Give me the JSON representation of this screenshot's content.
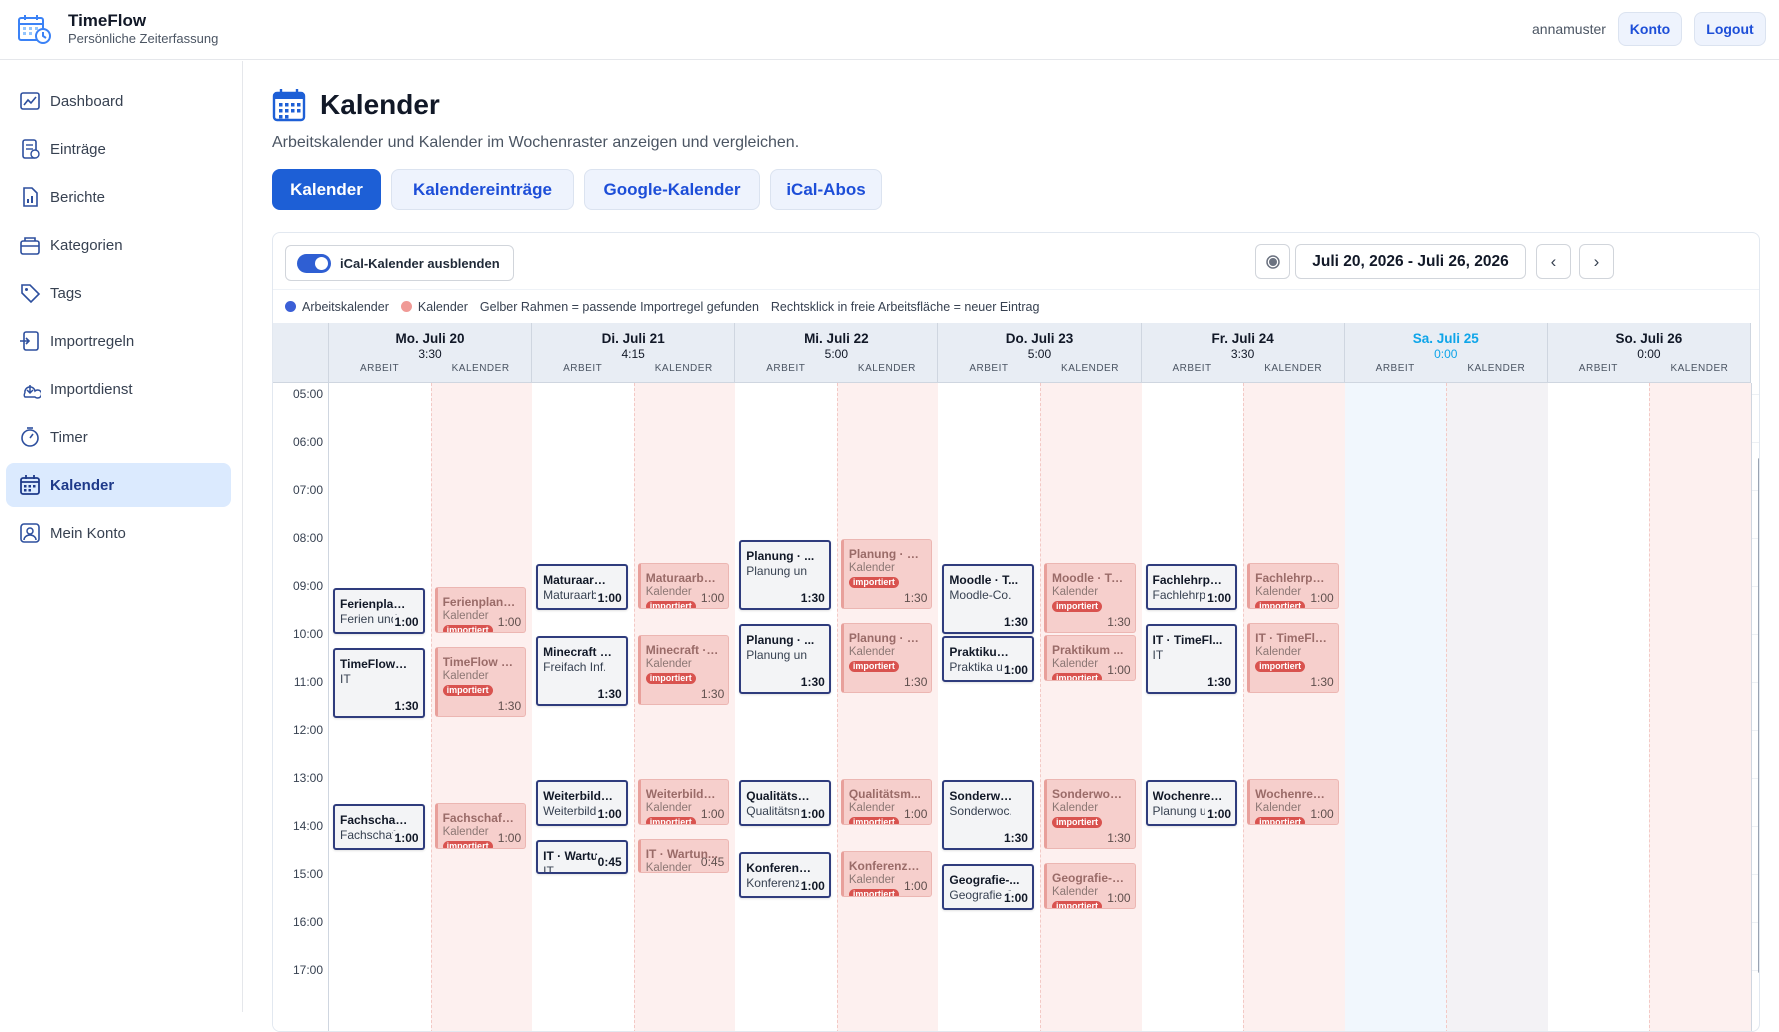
{
  "app": {
    "name": "TimeFlow",
    "subtitle": "Persönliche Zeiterfassung"
  },
  "header": {
    "username": "annamuster",
    "account_label": "Konto",
    "logout_label": "Logout"
  },
  "sidebar": {
    "items": [
      {
        "label": "Dashboard",
        "icon": "dashboard-icon"
      },
      {
        "label": "Einträge",
        "icon": "entries-icon"
      },
      {
        "label": "Berichte",
        "icon": "report-icon"
      },
      {
        "label": "Kategorien",
        "icon": "category-icon"
      },
      {
        "label": "Tags",
        "icon": "tag-icon"
      },
      {
        "label": "Importregeln",
        "icon": "import-rules-icon"
      },
      {
        "label": "Importdienst",
        "icon": "import-service-icon"
      },
      {
        "label": "Timer",
        "icon": "timer-icon"
      },
      {
        "label": "Kalender",
        "icon": "calendar-icon",
        "active": true
      },
      {
        "label": "Mein Konto",
        "icon": "user-icon"
      }
    ]
  },
  "page": {
    "title": "Kalender",
    "subtitle": "Arbeitskalender und Kalender im Wochenraster anzeigen und vergleichen."
  },
  "tabs": [
    {
      "label": "Kalender",
      "active": true
    },
    {
      "label": "Kalendereinträge"
    },
    {
      "label": "Google-Kalender"
    },
    {
      "label": "iCal-Abos"
    }
  ],
  "toolbar": {
    "toggle_label": "iCal-Kalender ausblenden",
    "toggle_on": true,
    "date_range": "Juli 20, 2026 - Juli 26, 2026",
    "prev": "‹",
    "next": "›"
  },
  "legend": {
    "work": "Arbeitskalender",
    "calendar": "Kalender",
    "rule_hint": "Gelber Rahmen = passende Importregel gefunden",
    "click_hint": "Rechtsklick in freie Arbeitsfläche = neuer Eintrag",
    "work_color": "#3b5fd6",
    "calendar_color": "#f09a96"
  },
  "columns": {
    "work": "ARBEIT",
    "calendar": "KALENDER"
  },
  "hours": [
    "05:00",
    "06:00",
    "07:00",
    "08:00",
    "09:00",
    "10:00",
    "11:00",
    "12:00",
    "13:00",
    "14:00",
    "15:00",
    "16:00",
    "17:00"
  ],
  "badge_label": "importiert",
  "calendar_sub": "Kalender",
  "days": [
    {
      "name": "Mo. Juli 20",
      "total": "3:30",
      "work": [
        {
          "title": "Ferienplan...",
          "sub": "Ferien und...",
          "dur": "1:00",
          "start": 9.0,
          "hours": 1.0
        },
        {
          "title": "TimeFlow ·...",
          "sub": "IT",
          "dur": "1:30",
          "start": 10.25,
          "hours": 1.5
        },
        {
          "title": "Fachschaft...",
          "sub": "Fachschaft...",
          "dur": "1:00",
          "start": 13.5,
          "hours": 1.0
        }
      ],
      "cal": [
        {
          "title": "Ferienplanu...",
          "dur": "1:00",
          "start": 9.0,
          "hours": 1.0
        },
        {
          "title": "TimeFlow · ...",
          "dur": "1:30",
          "start": 10.25,
          "hours": 1.5
        },
        {
          "title": "Fachschaft ...",
          "dur": "1:00",
          "start": 13.5,
          "hours": 1.0
        }
      ]
    },
    {
      "name": "Di. Juli 21",
      "total": "4:15",
      "work": [
        {
          "title": "Maturaarbe...",
          "sub": "Maturaarbe...",
          "dur": "1:00",
          "start": 8.5,
          "hours": 1.0
        },
        {
          "title": "Minecraft · ...",
          "sub": "Freifach Inf...",
          "dur": "1:30",
          "start": 10.0,
          "hours": 1.5
        },
        {
          "title": "Weiterbildu...",
          "sub": "Weiterbildu...",
          "dur": "1:00",
          "start": 13.0,
          "hours": 1.0
        },
        {
          "title": "IT · Wartun...",
          "sub": "IT",
          "dur": "0:45",
          "start": 14.25,
          "hours": 0.75
        }
      ],
      "cal": [
        {
          "title": "Maturaarbei...",
          "dur": "1:00",
          "start": 8.5,
          "hours": 1.0
        },
        {
          "title": "Minecraft · ...",
          "dur": "1:30",
          "start": 10.0,
          "hours": 1.5
        },
        {
          "title": "Weiterbildu...",
          "dur": "1:00",
          "start": 13.0,
          "hours": 1.0
        },
        {
          "title": "IT · Wartun...",
          "dur": "0:45",
          "start": 14.25,
          "hours": 0.75
        }
      ]
    },
    {
      "name": "Mi. Juli 22",
      "total": "5:00",
      "work": [
        {
          "title": "Planung · ...",
          "sub": "Planung un...",
          "dur": "1:30",
          "start": 8.0,
          "hours": 1.5
        },
        {
          "title": "Planung · ...",
          "sub": "Planung un...",
          "dur": "1:30",
          "start": 9.75,
          "hours": 1.5
        },
        {
          "title": "Qualitätsm...",
          "sub": "Qualitätsm...",
          "dur": "1:00",
          "start": 13.0,
          "hours": 1.0
        },
        {
          "title": "Konferenz ...",
          "sub": "Konferenz ...",
          "dur": "1:00",
          "start": 14.5,
          "hours": 1.0
        }
      ],
      "cal": [
        {
          "title": "Planung · G...",
          "dur": "1:30",
          "start": 8.0,
          "hours": 1.5
        },
        {
          "title": "Planung · G...",
          "dur": "1:30",
          "start": 9.75,
          "hours": 1.5
        },
        {
          "title": "Qualitätsm...",
          "dur": "1:00",
          "start": 13.0,
          "hours": 1.0
        },
        {
          "title": "Konferenzv...",
          "dur": "1:00",
          "start": 14.5,
          "hours": 1.0
        }
      ]
    },
    {
      "name": "Do. Juli 23",
      "total": "5:00",
      "work": [
        {
          "title": "Moodle · T...",
          "sub": "Moodle-Co...",
          "dur": "1:30",
          "start": 8.5,
          "hours": 1.5
        },
        {
          "title": "Praktikum ...",
          "sub": "Praktika u...",
          "dur": "1:00",
          "start": 10.0,
          "hours": 1.0
        },
        {
          "title": "Sonderwoc...",
          "sub": "Sonderwoc...",
          "dur": "1:30",
          "start": 13.0,
          "hours": 1.5
        },
        {
          "title": "Geografie-...",
          "sub": "Geografie-S...",
          "dur": "1:00",
          "start": 14.75,
          "hours": 1.0
        }
      ],
      "cal": [
        {
          "title": "Moodle · Te...",
          "dur": "1:30",
          "start": 8.5,
          "hours": 1.5
        },
        {
          "title": "Praktikum ...",
          "dur": "1:00",
          "start": 10.0,
          "hours": 1.0
        },
        {
          "title": "Sonderwoc...",
          "dur": "1:30",
          "start": 13.0,
          "hours": 1.5
        },
        {
          "title": "Geografie-S...",
          "dur": "1:00",
          "start": 14.75,
          "hours": 1.0
        }
      ]
    },
    {
      "name": "Fr. Juli 24",
      "total": "3:30",
      "work": [
        {
          "title": "Fachlehrpe...",
          "sub": "Fachlehrpe...",
          "dur": "1:00",
          "start": 8.5,
          "hours": 1.0
        },
        {
          "title": "IT · TimeFl...",
          "sub": "IT",
          "dur": "1:30",
          "start": 9.75,
          "hours": 1.5
        },
        {
          "title": "Wochenrev...",
          "sub": "Planung u...",
          "dur": "1:00",
          "start": 13.0,
          "hours": 1.0
        }
      ],
      "cal": [
        {
          "title": "Fachlehrpe...",
          "dur": "1:00",
          "start": 8.5,
          "hours": 1.0
        },
        {
          "title": "IT · TimeFlo...",
          "dur": "1:30",
          "start": 9.75,
          "hours": 1.5
        },
        {
          "title": "Wochenrevi...",
          "dur": "1:00",
          "start": 13.0,
          "hours": 1.0
        }
      ]
    },
    {
      "name": "Sa. Juli 25",
      "total": "0:00",
      "weekend": true,
      "work": [],
      "cal": []
    },
    {
      "name": "So. Juli 26",
      "total": "0:00",
      "work": [],
      "cal": []
    }
  ]
}
